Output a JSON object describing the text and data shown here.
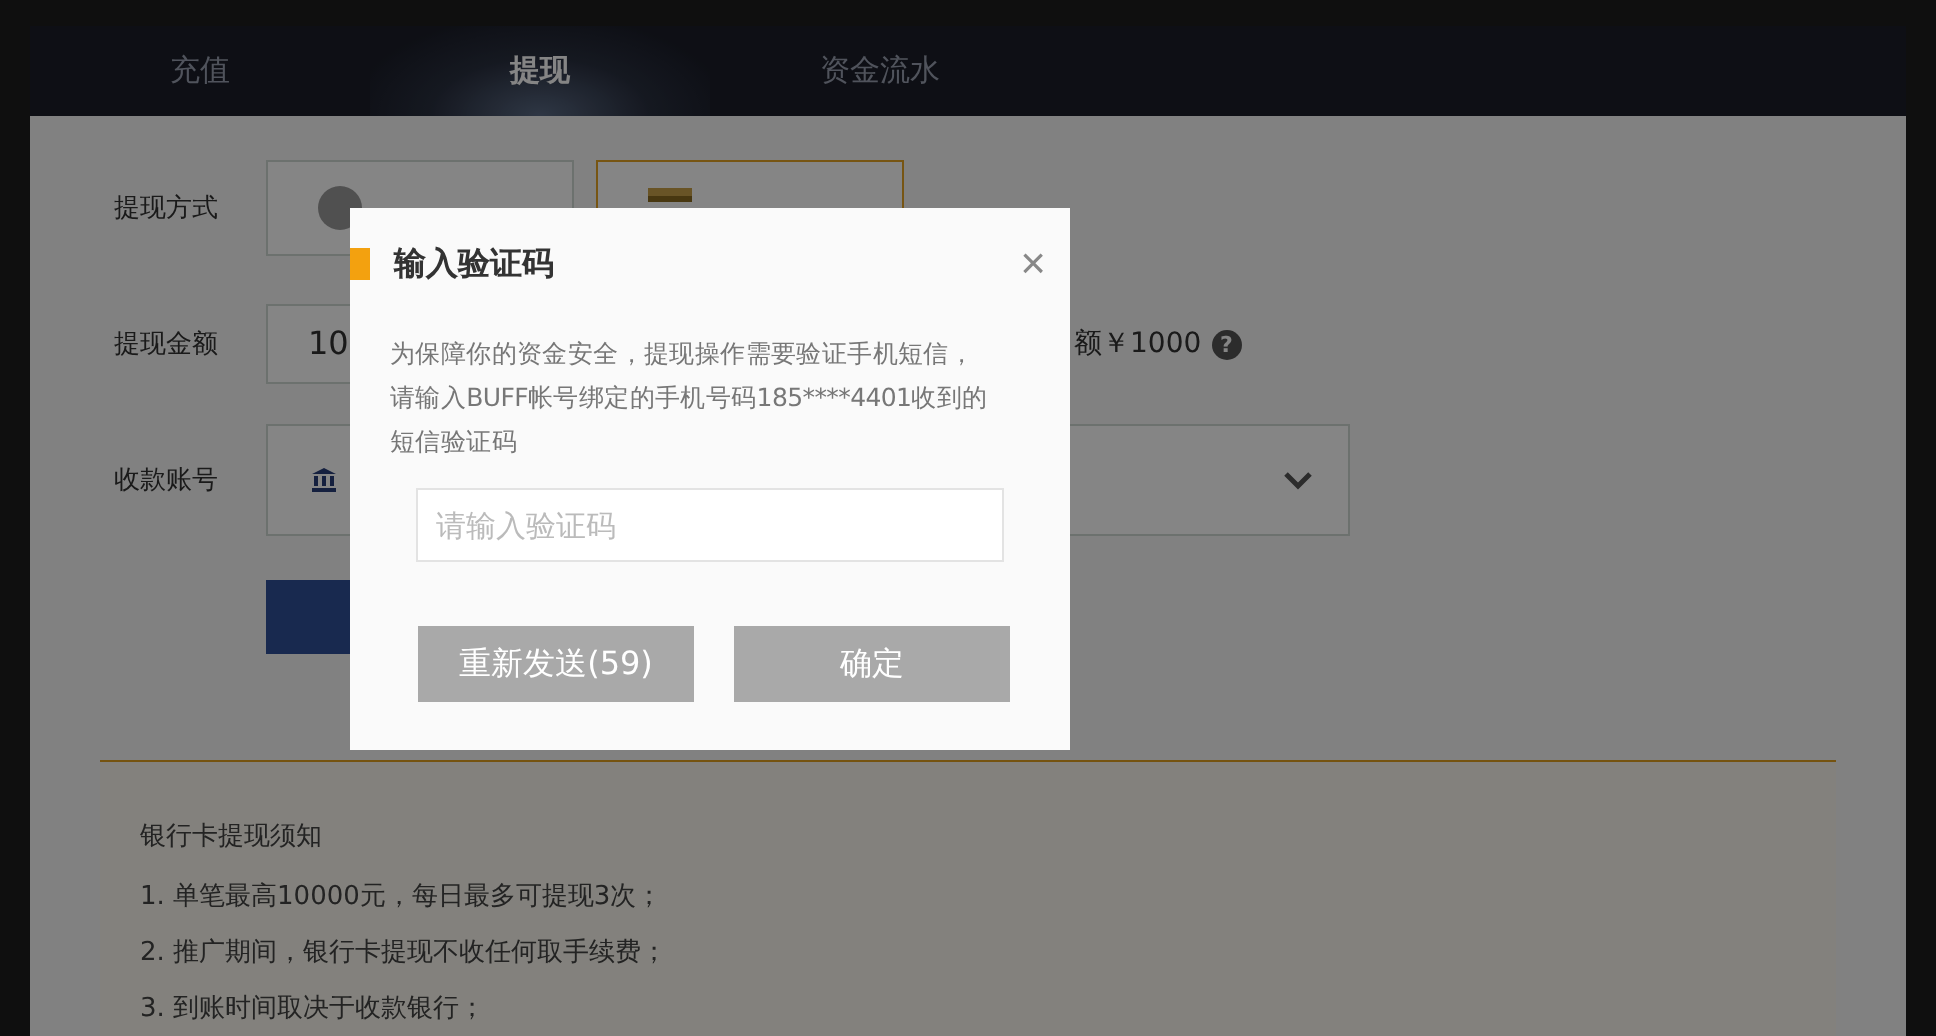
{
  "tabs": [
    {
      "label": "充值",
      "selected": false
    },
    {
      "label": "提现",
      "selected": true
    },
    {
      "label": "资金流水",
      "selected": false
    }
  ],
  "form": {
    "method_label": "提现方式",
    "methods": [
      {
        "kind": "alipay",
        "selected": false
      },
      {
        "kind": "bank",
        "selected": true
      }
    ],
    "amount_label": "提现金额",
    "amount_value": "10",
    "balance_note": "额￥1000",
    "help_icon": "?",
    "account_label": "收款账号"
  },
  "notice": {
    "title": "银行卡提现须知",
    "items": [
      "1. 单笔最高10000元，每日最多可提现3次；",
      "2. 推广期间，银行卡提现不收任何取手续费；",
      "3. 到账时间取决于收款银行；"
    ]
  },
  "dialog": {
    "title": "输入验证码",
    "close": "×",
    "message": "为保障你的资金安全，提现操作需要验证手机短信，请输入BUFF帐号绑定的手机号码185****4401收到的短信验证码",
    "placeholder": "请输入验证码",
    "resend_button": "重新发送(59)",
    "confirm_button": "确定",
    "buttons_disabled": true
  }
}
